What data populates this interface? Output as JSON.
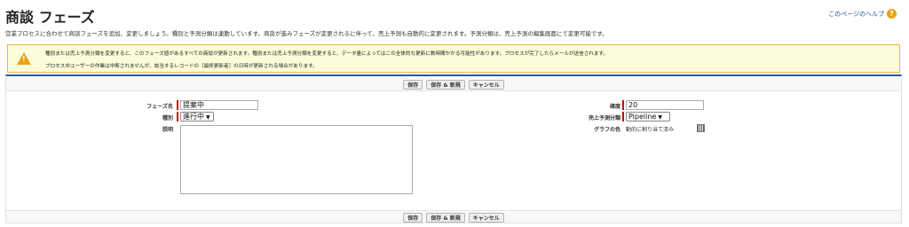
{
  "header": {
    "title": "商談 フェーズ",
    "help_link": "このページのヘルプ",
    "description": "営業プロセスに合わせて商談フェーズを追加、変更しましょう。種別と予測分類は連動しています。商談が進みフェーズが変更されるに伴って、売上予測も自動的に変更されます。予測分類は、売上予測の編集画面にて変更可能です。"
  },
  "warning": {
    "line1": "種別または売上予測分類を変更すると、このフェーズ値があるすべての商談が更新されます。種別または売上予測分類を変更すると、データ量によってはこの全体的な更新に数時間かかる可能性があります。プロセスが完了したらメールが送信されます。",
    "line2": "プロセス中ユーザーの作業は中断されませんが、該当するレコードの［最終更新者］の日時が更新される場合があります。"
  },
  "buttons": {
    "save": "保存",
    "save_new": "保存 & 新規",
    "cancel": "キャンセル"
  },
  "form": {
    "phase_name_label": "フェーズ名",
    "phase_name_value": "提案中",
    "type_label": "種別",
    "type_value": "進行中",
    "description_label": "説明",
    "probability_label": "確度",
    "probability_value": "20",
    "forecast_label": "売上予測分類",
    "forecast_value": "Pipeline",
    "chart_color_label": "グラフの色",
    "chart_color_value": "動的に割り当て済み"
  },
  "colors": {
    "required": "#cc0000",
    "panel_accent": "#1f5fa6",
    "warning_border": "#e9b93a",
    "warning_bg": "#fcfcd9"
  },
  "icons": {
    "help": "help-icon",
    "warning": "warning-icon",
    "color_picker": "color-picker-icon"
  }
}
